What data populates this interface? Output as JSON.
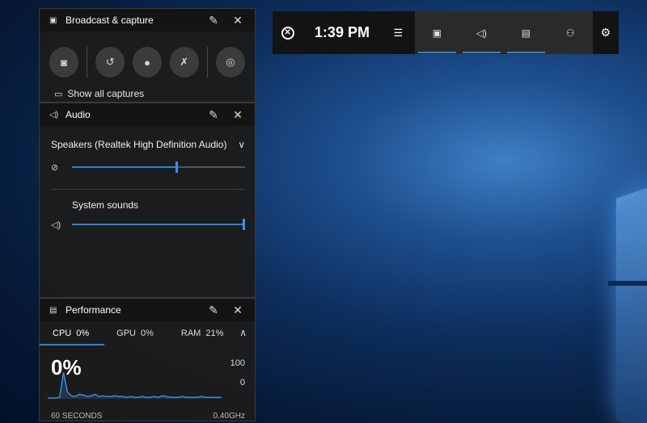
{
  "broadcast": {
    "title": "Broadcast & capture",
    "title_icon": "broadcast-icon",
    "buttons": [
      "screenshot-icon",
      "record-last-icon",
      "record-icon",
      "mic-off-icon",
      "broadcast-live-icon"
    ],
    "show_all_captures": "Show all captures"
  },
  "audio": {
    "title": "Audio",
    "title_icon": "speaker-icon",
    "device": "Speakers (Realtek High Definition Audio)",
    "master_volume": 0.6,
    "master_muted_icon": "speaker-muted-icon",
    "system_sounds_label": "System sounds",
    "system_sounds_volume": 1.0
  },
  "performance": {
    "title": "Performance",
    "tabs": [
      {
        "label": "CPU",
        "value": "0%"
      },
      {
        "label": "GPU",
        "value": "0%"
      },
      {
        "label": "RAM",
        "value": "21%"
      }
    ],
    "big_value": "0%",
    "scale_max": "100",
    "scale_min": "0",
    "footer_left": "60 SECONDS",
    "footer_right": "0.40GHz",
    "cpu_history": [
      1,
      1,
      1,
      2,
      35,
      9,
      4,
      3,
      6,
      5,
      3,
      4,
      6,
      3,
      4,
      3,
      3,
      4,
      3,
      3,
      2,
      3,
      2,
      2,
      3,
      2,
      2,
      3,
      2,
      4,
      3,
      2,
      2,
      2,
      3,
      2,
      2,
      2,
      2,
      3,
      2,
      2,
      2,
      2,
      2
    ]
  },
  "topbar": {
    "clock": "1:39 PM",
    "widgets": [
      "capture-widget-icon",
      "audio-widget-icon",
      "performance-widget-icon",
      "social-widget-icon"
    ],
    "accent": "#2f7fd6"
  }
}
